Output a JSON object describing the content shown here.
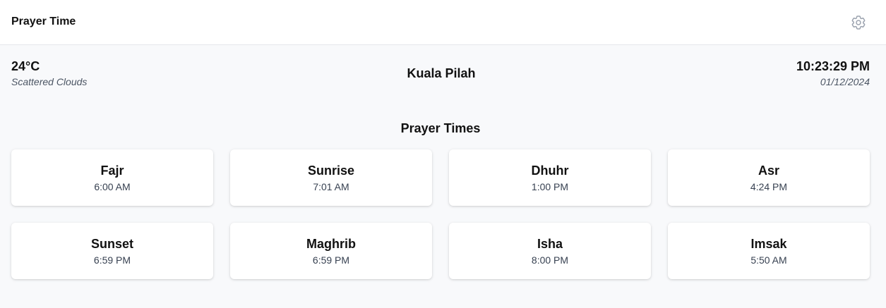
{
  "header": {
    "title": "Prayer Time",
    "settings_icon": "gear-icon"
  },
  "weather": {
    "temperature": "24°C",
    "description": "Scattered Clouds"
  },
  "location": {
    "city": "Kuala Pilah"
  },
  "clock": {
    "time": "10:23:29 PM",
    "date": "01/12/2024"
  },
  "prayer_section": {
    "title": "Prayer Times",
    "prayers": [
      {
        "name": "Fajr",
        "time": "6:00 AM"
      },
      {
        "name": "Sunrise",
        "time": "7:01 AM"
      },
      {
        "name": "Dhuhr",
        "time": "1:00 PM"
      },
      {
        "name": "Asr",
        "time": "4:24 PM"
      },
      {
        "name": "Sunset",
        "time": "6:59 PM"
      },
      {
        "name": "Maghrib",
        "time": "6:59 PM"
      },
      {
        "name": "Isha",
        "time": "8:00 PM"
      },
      {
        "name": "Imsak",
        "time": "5:50 AM"
      }
    ]
  }
}
